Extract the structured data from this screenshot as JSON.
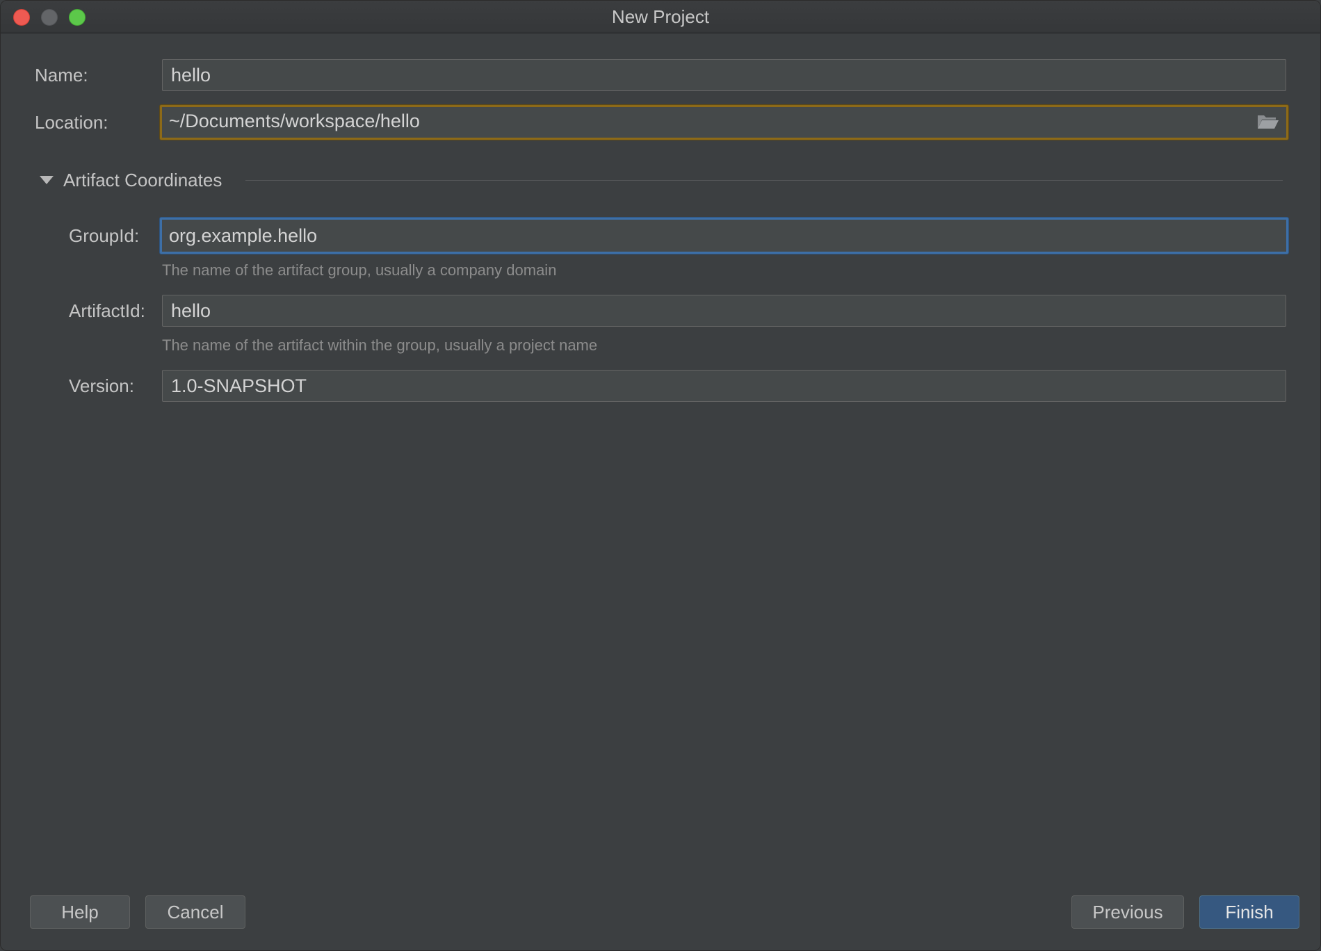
{
  "window": {
    "title": "New Project"
  },
  "form": {
    "name_label": "Name:",
    "name_value": "hello",
    "location_label": "Location:",
    "location_value": "~/Documents/workspace/hello"
  },
  "artifact_section": {
    "title": "Artifact Coordinates",
    "expanded": true,
    "group_id_label": "GroupId:",
    "group_id_value": "org.example.hello",
    "group_id_hint": "The name of the artifact group, usually a company domain",
    "artifact_id_label": "ArtifactId:",
    "artifact_id_value": "hello",
    "artifact_id_hint": "The name of the artifact within the group, usually a project name",
    "version_label": "Version:",
    "version_value": "1.0-SNAPSHOT"
  },
  "buttons": {
    "help": "Help",
    "cancel": "Cancel",
    "previous": "Previous",
    "finish": "Finish"
  },
  "colors": {
    "background": "#3c3f41",
    "field_background": "#45494a",
    "location_border": "#8d6a18",
    "focus_border": "#3d6fa7",
    "primary_button": "#365880"
  },
  "icons": {
    "location_browse": "folder-open-icon",
    "section_toggle": "triangle-down-icon"
  }
}
